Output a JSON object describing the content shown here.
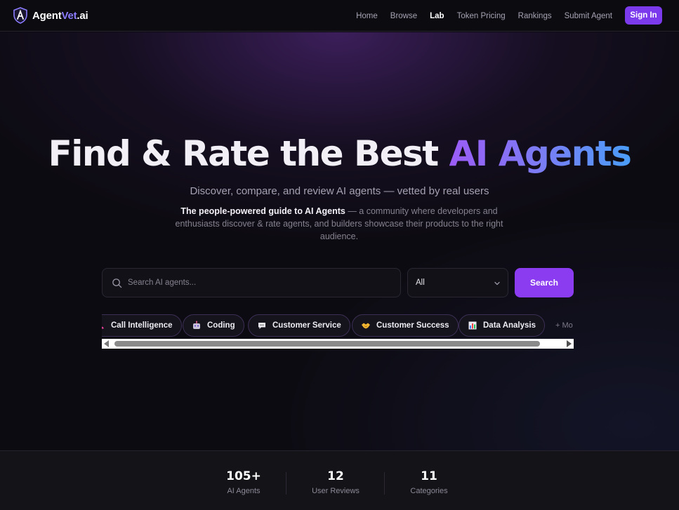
{
  "nav": {
    "logo_primary": "Agent",
    "logo_accent": "Vet",
    "logo_suffix": ".ai",
    "links": [
      {
        "label": "Home",
        "active": false
      },
      {
        "label": "Browse",
        "active": false
      },
      {
        "label": "Lab",
        "active": true
      },
      {
        "label": "Token Pricing",
        "active": false
      },
      {
        "label": "Rankings",
        "active": false
      },
      {
        "label": "Submit Agent",
        "active": false
      }
    ],
    "signin_label": "Sign In"
  },
  "hero": {
    "title_main": "Find & Rate the Best ",
    "title_accent": "AI Agents",
    "subtitle": "Discover, compare, and review AI agents — vetted by real users",
    "desc_strong": "The people-powered guide to AI Agents",
    "desc_rest": " — a community where developers and enthusiasts discover & rate agents, and builders showcase their products to the right audience."
  },
  "search": {
    "placeholder": "Search AI agents...",
    "value": "",
    "filter_value": "All",
    "button_label": "Search"
  },
  "categories": {
    "chips": [
      {
        "label": "Call Intelligence",
        "icon": "phone-icon"
      },
      {
        "label": "Coding",
        "icon": "robot-icon"
      },
      {
        "label": "Customer Service",
        "icon": "speech-bubble-icon"
      },
      {
        "label": "Customer Success",
        "icon": "handshake-icon"
      },
      {
        "label": "Data Analysis",
        "icon": "bar-chart-icon"
      }
    ],
    "more_label": "+ Mo"
  },
  "stats": [
    {
      "value": "105+",
      "label": "AI Agents"
    },
    {
      "value": "12",
      "label": "User Reviews"
    },
    {
      "value": "11",
      "label": "Categories"
    }
  ],
  "colors": {
    "accent": "#8b3cf0",
    "logo_accent": "#8b7cff",
    "background": "#0d0b12"
  }
}
